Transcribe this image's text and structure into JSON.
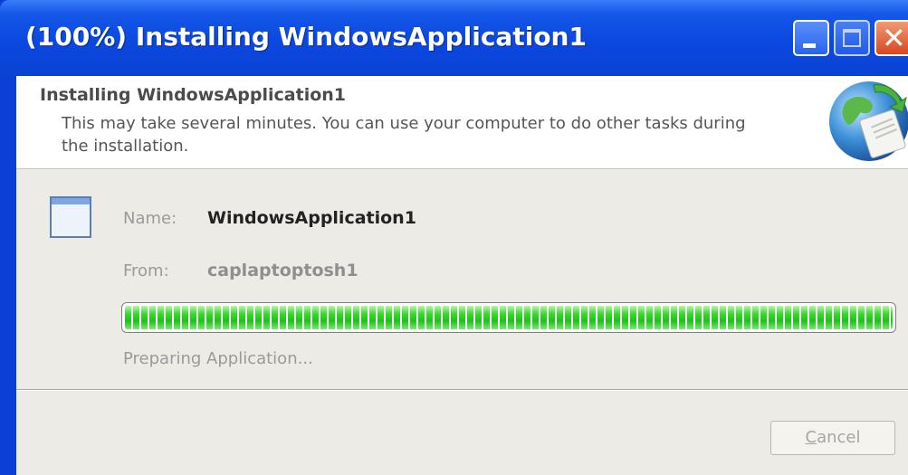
{
  "window": {
    "title": "(100%) Installing WindowsApplication1"
  },
  "header": {
    "title": "Installing WindowsApplication1",
    "description": "This may take several minutes. You can use your computer to do other tasks during the installation."
  },
  "details": {
    "name_label": "Name:",
    "name_value": "WindowsApplication1",
    "from_label": "From:",
    "from_value": "caplaptoptosh1"
  },
  "progress": {
    "percent": 100,
    "status_text": "Preparing Application..."
  },
  "buttons": {
    "cancel_label_first": "C",
    "cancel_label_rest": "ancel"
  },
  "icons": {
    "header": "globe-install-icon",
    "application": "application-window-icon",
    "minimize": "minimize-icon",
    "maximize": "maximize-icon",
    "close": "close-icon"
  },
  "colors": {
    "titlebar": "#0b48e0",
    "progress_fill": "#2ad11f",
    "close_button": "#d8471f"
  }
}
